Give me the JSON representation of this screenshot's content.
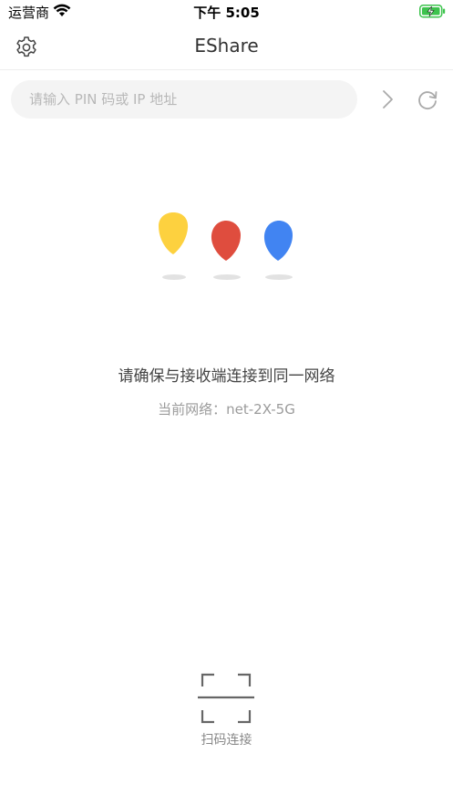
{
  "status_bar": {
    "carrier": "运营商",
    "time": "下午 5:05"
  },
  "nav": {
    "title": "EShare"
  },
  "search": {
    "placeholder": "请输入 PIN 码或 IP 地址",
    "value": ""
  },
  "message": {
    "hint": "请确保与接收端连接到同一网络",
    "network_label": "当前网络：",
    "network_name": "net-2X-5G"
  },
  "scan": {
    "label": "扫码连接"
  },
  "colors": {
    "balloon_yellow": "#FDD13F",
    "balloon_red": "#DF4D3E",
    "balloon_blue": "#4184F2",
    "battery_green": "#3DC34D"
  },
  "icons": {
    "settings": "gear-icon",
    "go": "chevron-right-icon",
    "refresh": "refresh-icon",
    "scan": "scan-frame-icon"
  }
}
